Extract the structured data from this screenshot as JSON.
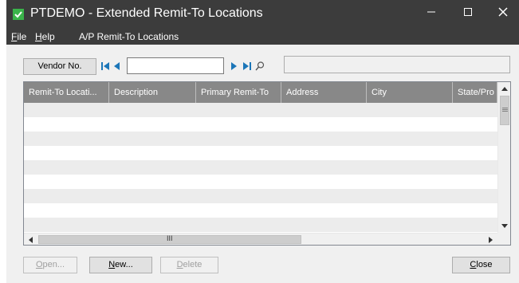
{
  "window": {
    "title": "PTDEMO - Extended Remit-To Locations",
    "controls": {
      "minimize": "–",
      "maximize": "□",
      "close": "✕"
    }
  },
  "menu": {
    "items": [
      {
        "label": "File",
        "accel": "F",
        "rest": "ile"
      },
      {
        "label": "Help",
        "accel": "H",
        "rest": "elp"
      },
      {
        "label": "A/P Remit-To Locations"
      }
    ]
  },
  "toolbar": {
    "vendor_button": "Vendor No.",
    "vendor_value": "",
    "vendor_name": "",
    "icons": [
      "first-record-icon",
      "previous-record-icon",
      "next-record-icon",
      "last-record-icon",
      "finder-icon"
    ]
  },
  "grid": {
    "columns": [
      "Remit-To Locati...",
      "Description",
      "Primary Remit-To",
      "Address",
      "City",
      "State/Pro"
    ],
    "row_count": 9,
    "rows": [],
    "hscroll_grip": "III"
  },
  "buttons": {
    "open": {
      "label": "Open...",
      "accel": "O",
      "rest": "pen...",
      "enabled": false
    },
    "new": {
      "label": "New...",
      "accel": "N",
      "rest": "ew...",
      "enabled": true
    },
    "delete": {
      "label": "Delete",
      "accel": "D",
      "rest": "elete",
      "enabled": false
    },
    "close": {
      "label": "Close",
      "accel": "C",
      "rest": "lose",
      "enabled": true
    }
  },
  "colors": {
    "titlebar": "#3c3c3c",
    "grid_header": "#888888",
    "nav_arrow": "#1b76b8",
    "app_icon": "#3ab34a"
  }
}
